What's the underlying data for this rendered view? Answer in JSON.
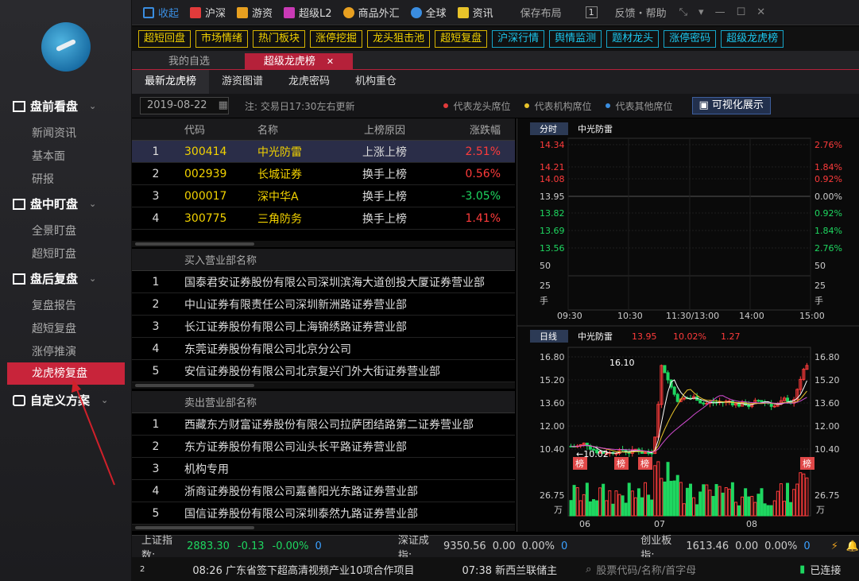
{
  "sidebar": {
    "sections": [
      {
        "label": "盘前看盘",
        "items": [
          "新闻资讯",
          "基本面",
          "研报"
        ]
      },
      {
        "label": "盘中盯盘",
        "items": [
          "全景盯盘",
          "超短盯盘"
        ]
      },
      {
        "label": "盘后复盘",
        "items": [
          "复盘报告",
          "超短复盘",
          "涨停推演",
          "龙虎榜复盘"
        ]
      },
      {
        "label": "自定义方案",
        "items": []
      }
    ],
    "active": "龙虎榜复盘"
  },
  "topbar": {
    "items": [
      "收起",
      "沪深",
      "游资",
      "超级L2",
      "商品外汇",
      "全球",
      "资讯",
      "保存布局",
      "1",
      "反馈・帮助"
    ]
  },
  "quick": {
    "yellow": [
      "超短回盘",
      "市场情绪",
      "热门板块",
      "涨停挖掘",
      "龙头狙击池",
      "超短复盘"
    ],
    "cyan": [
      "沪深行情",
      "舆情监测",
      "题材龙头",
      "涨停密码",
      "超级龙虎榜"
    ]
  },
  "tabs1": [
    "我的自选",
    "超级龙虎榜"
  ],
  "tabs2": [
    "最新龙虎榜",
    "游资图谱",
    "龙虎密码",
    "机构重仓"
  ],
  "datebar": {
    "date": "2019-08-22",
    "note": "注: 交易日17:30左右更新",
    "legend": [
      "代表龙头席位",
      "代表机构席位",
      "代表其他席位"
    ],
    "legend_colors": [
      "#e23b3b",
      "#e8c32a",
      "#3a8de0"
    ],
    "visual_btn": "可视化展示"
  },
  "stocks": {
    "headers": [
      "代码",
      "名称",
      "上榜原因",
      "涨跌幅"
    ],
    "rows": [
      {
        "no": "1",
        "code": "300414",
        "name": "中光防雷",
        "reason": "上涨上榜",
        "pct": "2.51%",
        "dir": "up"
      },
      {
        "no": "2",
        "code": "002939",
        "name": "长城证券",
        "reason": "换手上榜",
        "pct": "0.56%",
        "dir": "up"
      },
      {
        "no": "3",
        "code": "000017",
        "name": "深中华A",
        "reason": "换手上榜",
        "pct": "-3.05%",
        "dir": "down"
      },
      {
        "no": "4",
        "code": "300775",
        "name": "三角防务",
        "reason": "换手上榜",
        "pct": "1.41%",
        "dir": "up"
      }
    ]
  },
  "buy": {
    "header": "买入营业部名称",
    "rows": [
      "国泰君安证券股份有限公司深圳滨海大道创投大厦证券营业部",
      "中山证券有限责任公司深圳新洲路证券营业部",
      "长江证券股份有限公司上海锦绣路证券营业部",
      "东莞证券股份有限公司北京分公司",
      "安信证券股份有限公司北京复兴门外大街证券营业部"
    ]
  },
  "sell": {
    "header": "卖出营业部名称",
    "rows": [
      "西藏东方财富证券股份有限公司拉萨团结路第二证券营业部",
      "东方证券股份有限公司汕头长平路证券营业部",
      "机构专用",
      "浙商证券股份有限公司嘉善阳光东路证券营业部",
      "国信证券股份有限公司深圳泰然九路证券营业部"
    ]
  },
  "intraday": {
    "period": "分时",
    "name": "中光防雷",
    "left_ticks": [
      "14.34",
      "14.21",
      "14.08",
      "13.95",
      "13.82",
      "13.69",
      "13.56",
      "50",
      "25",
      "手"
    ],
    "right_ticks": [
      "2.76%",
      "1.84%",
      "0.92%",
      "0.00%",
      "0.92%",
      "1.84%",
      "2.76%",
      "50",
      "25",
      "手"
    ],
    "x_ticks": [
      "09:30",
      "10:30",
      "11:30/13:00",
      "14:00",
      "15:00"
    ]
  },
  "daily": {
    "period": "日线",
    "name": "中光防雷",
    "price": "13.95",
    "pct": "10.02%",
    "chg": "1.27",
    "left_ticks": [
      "16.80",
      "15.20",
      "13.60",
      "12.00",
      "10.40"
    ],
    "right_ticks": [
      "16.80",
      "15.20",
      "13.60",
      "12.00",
      "10.40"
    ],
    "vol_tick": "26.75",
    "vol_unit": "万",
    "x_ticks": [
      "06",
      "07",
      "08"
    ],
    "high_label": "16.10",
    "low_label": "10.02",
    "badge": "榜"
  },
  "status": {
    "sh_label": "上证指数:",
    "sh_val": "2883.30",
    "sh_chg": "-0.13",
    "sh_pct": "-0.00%",
    "sh_n": "0",
    "sz_label": "深证成指:",
    "sz_val": "9350.56",
    "sz_chg": "0.00",
    "sz_pct": "0.00%",
    "sz_n": "0",
    "cy_label": "创业板指:",
    "cy_val": "1613.46",
    "cy_chg": "0.00",
    "cy_pct": "0.00%",
    "cy_n": "0"
  },
  "ticker": {
    "n": "2",
    "news1": "08:26 广东省签下超高清视频产业10项合作项目",
    "news2": "07:38 新西兰联储主",
    "search_placeholder": "股票代码/名称/首字母",
    "conn": "已连接"
  }
}
